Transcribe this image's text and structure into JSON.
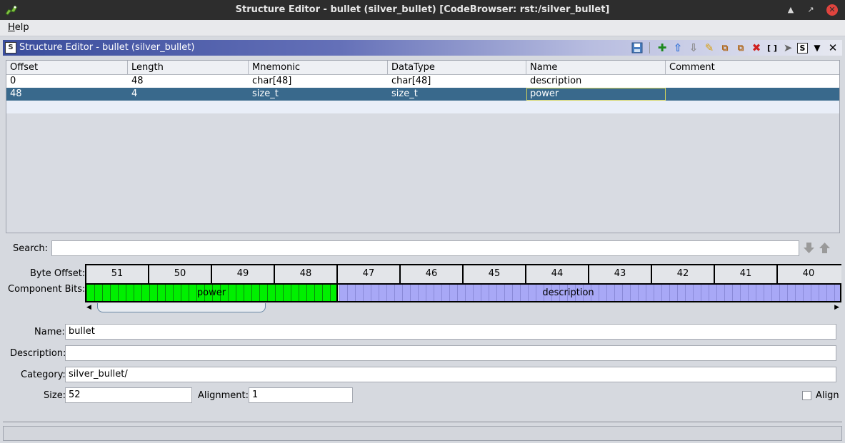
{
  "window": {
    "title": "Structure Editor - bullet (silver_bullet) [CodeBrowser: rst:/silver_bullet]"
  },
  "menubar": {
    "help_label": "Help"
  },
  "provider": {
    "title": "Structure Editor - bullet (silver_bullet)",
    "toolbar_icons": [
      "save-icon",
      "add-icon",
      "move-up-icon",
      "move-down-icon",
      "clear-icon",
      "duplicate-icon",
      "duplicate-multiple-icon",
      "delete-icon",
      "array-icon",
      "pointer-icon",
      "show-components-icon",
      "menu-dropdown-icon",
      "close-icon"
    ]
  },
  "table": {
    "columns": [
      "Offset",
      "Length",
      "Mnemonic",
      "DataType",
      "Name",
      "Comment"
    ],
    "rows": [
      [
        "0",
        "48",
        "char[48]",
        "char[48]",
        "description",
        ""
      ],
      [
        "48",
        "4",
        "size_t",
        "size_t",
        "power",
        ""
      ]
    ],
    "selected_row": 1
  },
  "search": {
    "label": "Search:",
    "value": ""
  },
  "bitview": {
    "byte_offset_label": "Byte Offset:",
    "component_bits_label": "Component Bits:",
    "byte_offsets": [
      "51",
      "50",
      "49",
      "48",
      "47",
      "46",
      "45",
      "44",
      "43",
      "42",
      "41",
      "40"
    ],
    "components": [
      {
        "name": "power",
        "color": "#00f000"
      },
      {
        "name": "description",
        "color": "#a8a8f6"
      }
    ]
  },
  "fields": {
    "name_label": "Name:",
    "name_value": "bullet",
    "description_label": "Description:",
    "description_value": "",
    "category_label": "Category:",
    "category_value": "silver_bullet/",
    "size_label": "Size:",
    "size_value": "52",
    "alignment_label": "Alignment:",
    "alignment_value": "1",
    "align_label": "Align",
    "align_checked": false
  },
  "colors": {
    "selection": "#39698c",
    "header_gradient_start": "#3a4d9c"
  }
}
